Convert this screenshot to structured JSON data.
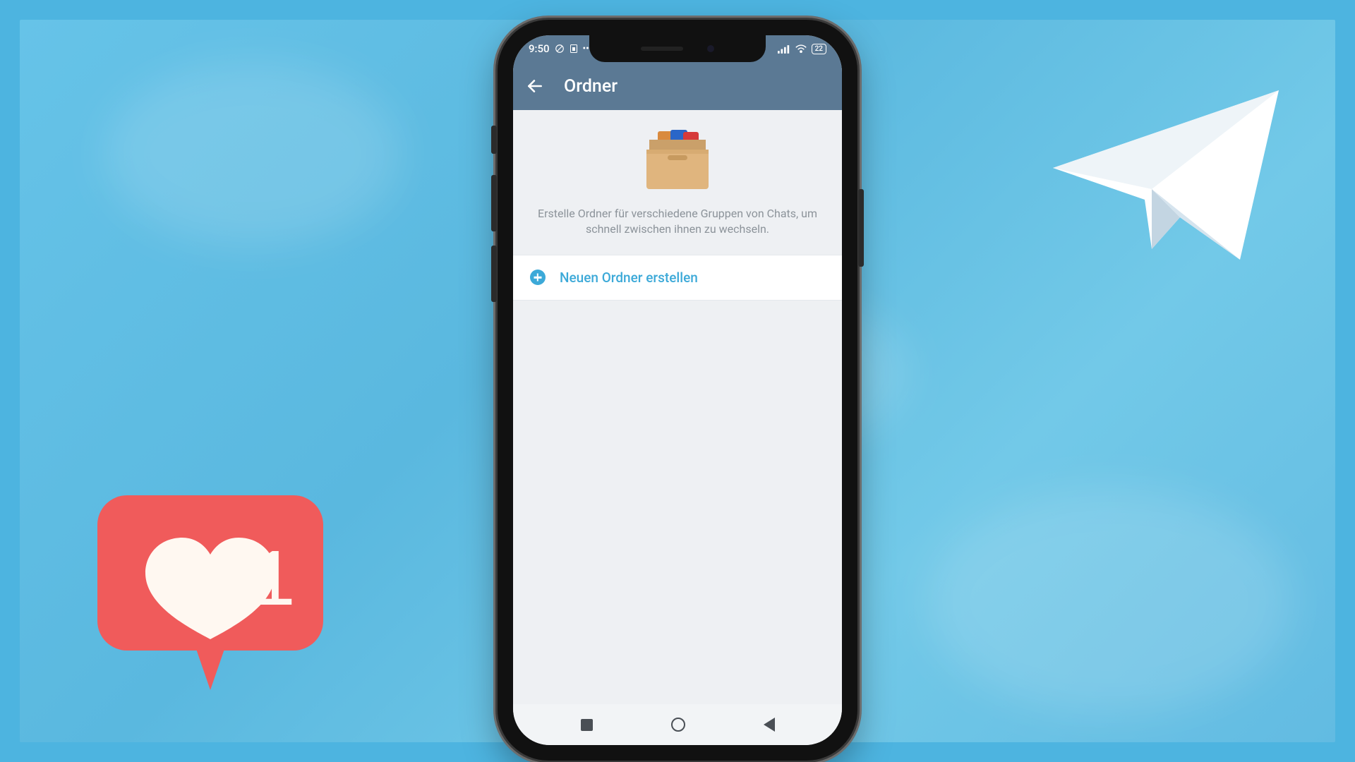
{
  "status_bar": {
    "time": "9:50",
    "battery_percent": "22"
  },
  "appbar": {
    "title": "Ordner"
  },
  "hero": {
    "description": "Erstelle Ordner für verschiedene Gruppen von Chats, um schnell zwischen ihnen zu wechseln."
  },
  "actions": {
    "create_folder_label": "Neuen Ordner erstellen"
  },
  "like_badge": {
    "count": "1"
  }
}
